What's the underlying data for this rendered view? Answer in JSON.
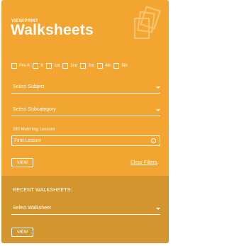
{
  "header": {
    "eyebrow": "VIEW/PRINT",
    "title": "Walksheets",
    "logo_icon": "stacked-papers-icon"
  },
  "grades": [
    {
      "label": "Pre-K",
      "checked": false
    },
    {
      "label": "K",
      "checked": false
    },
    {
      "label": "1st",
      "checked": false
    },
    {
      "label": "2nd",
      "checked": false
    },
    {
      "label": "3rd",
      "checked": false
    },
    {
      "label": "4th",
      "checked": false
    },
    {
      "label": "5th",
      "checked": false
    }
  ],
  "subject": {
    "label": "Select Subject"
  },
  "subcategory": {
    "label": "Select Subcategory"
  },
  "results": {
    "count_text": "280 Matching Lessons"
  },
  "search": {
    "placeholder": "Find Lesson",
    "value": ""
  },
  "actions": {
    "view_label": "VIEW",
    "clear_label": "Clear Filters"
  },
  "recent": {
    "heading": "RECENT WALKSHEETS:",
    "select_label": "Select Walksheet",
    "view_label": "VIEW"
  },
  "colors": {
    "panel": "#F2A530",
    "recent_panel": "#D3962E",
    "text": "#FFFFFF"
  }
}
